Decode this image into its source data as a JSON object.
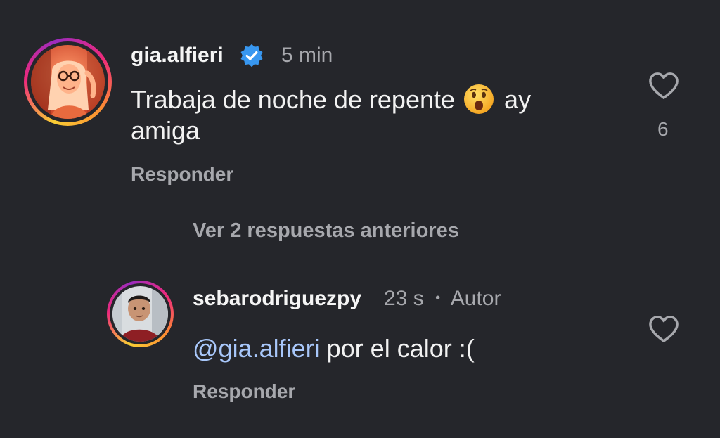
{
  "comment": {
    "username": "gia.alfieri",
    "verified": true,
    "time": "5 min",
    "text_before_emoji": "Trabaja de noche de repente",
    "emoji": "astonished-face",
    "text_after_emoji": "ay",
    "text_line2": "amiga",
    "reply_label": "Responder",
    "likes": "6"
  },
  "view_replies": "Ver 2 respuestas anteriores",
  "reply": {
    "username": "sebarodriguezpy",
    "time": "23 s",
    "separator": "•",
    "author_badge": "Autor",
    "mention": "@gia.alfieri",
    "text": "por el calor :(",
    "reply_label": "Responder"
  },
  "icons": {
    "verified": "verified-badge-icon",
    "like": "heart-outline-icon"
  },
  "colors": {
    "background": "#25262b",
    "verified_blue": "#3897f0",
    "mention_blue": "#a8c7fa",
    "muted_text": "#a7a8ad"
  }
}
